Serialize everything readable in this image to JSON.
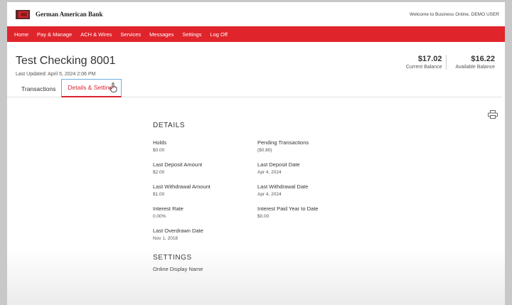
{
  "brand": {
    "name": "German American Bank"
  },
  "header": {
    "welcome": "Welcome to Business Online, DEMO USER"
  },
  "nav": {
    "items": [
      {
        "label": "Home"
      },
      {
        "label": "Pay & Manage"
      },
      {
        "label": "ACH & Wires"
      },
      {
        "label": "Services"
      },
      {
        "label": "Messages"
      },
      {
        "label": "Settings"
      },
      {
        "label": "Log Off"
      }
    ]
  },
  "account": {
    "title": "Test Checking 8001",
    "last_updated": "Last Updated: April 5, 2024 2:06 PM",
    "balances": {
      "current": {
        "value": "$17.02",
        "label": "Current Balance"
      },
      "available": {
        "value": "$16.22",
        "label": "Available Balance"
      }
    }
  },
  "tabs": [
    {
      "label": "Transactions",
      "active": false
    },
    {
      "label": "Details & Settings",
      "active": true
    }
  ],
  "details": {
    "heading": "DETAILS",
    "fields": [
      {
        "label": "Holds",
        "value": "$0.00"
      },
      {
        "label": "Pending Transactions",
        "value": "($0.80)"
      },
      {
        "label": "Last Deposit Amount",
        "value": "$2.00"
      },
      {
        "label": "Last Deposit Date",
        "value": "Apr 4, 2024"
      },
      {
        "label": "Last Withdrawal Amount",
        "value": "$1.00"
      },
      {
        "label": "Last Withdrawal Date",
        "value": "Apr 4, 2024"
      },
      {
        "label": "Interest Rate",
        "value": "0.00%"
      },
      {
        "label": "Interest Paid Year to Date",
        "value": "$0.00"
      },
      {
        "label": "Last Overdrawn Date",
        "value": "Nov 1, 2018"
      }
    ]
  },
  "settings": {
    "heading": "SETTINGS",
    "display_name_label": "Online Display Name"
  },
  "colors": {
    "brand_red": "#e0242c",
    "tab_focus": "#6ab0e0"
  }
}
